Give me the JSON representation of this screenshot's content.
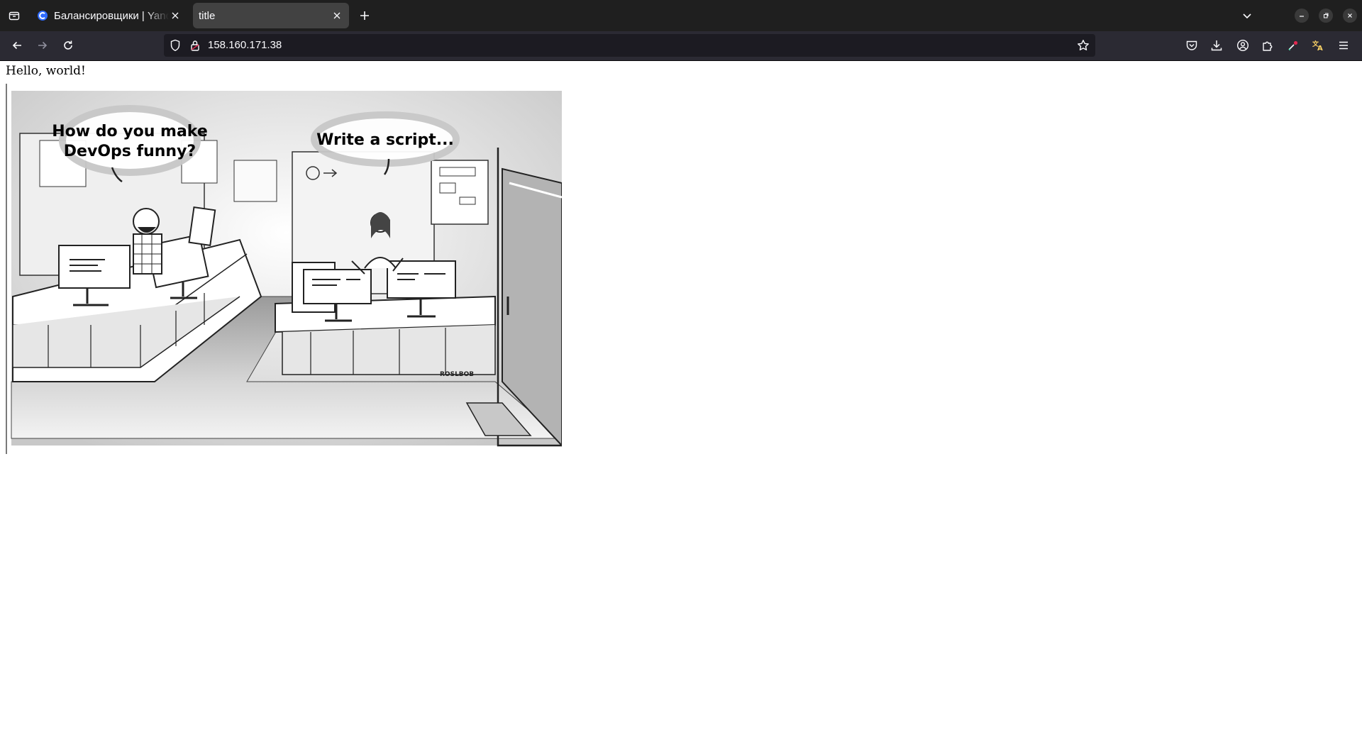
{
  "browser": {
    "tabs": [
      {
        "title": "Балансировщики | Yandex Cloud",
        "active": false,
        "favicon": "yandex-cloud-icon"
      },
      {
        "title": "title",
        "active": true
      }
    ],
    "url": "158.160.171.38",
    "icons": [
      "tab-list-icon",
      "new-tab-icon",
      "list-all-tabs-icon",
      "minimize-icon",
      "restore-icon",
      "close-icon",
      "back-icon",
      "forward-icon",
      "reload-icon",
      "shield-icon",
      "lock-icon",
      "bookmark-star-icon",
      "pocket-icon",
      "downloads-icon",
      "account-icon",
      "extensions-icon",
      "color-picker-icon",
      "translate-icon",
      "menu-icon"
    ],
    "accent": "#0060df"
  },
  "page": {
    "text": "Hello, world!",
    "comic": {
      "bubble_left": [
        "How do you make",
        "DevOps funny?"
      ],
      "bubble_right": "Write a script...",
      "signature": "ROSLBOB"
    }
  }
}
